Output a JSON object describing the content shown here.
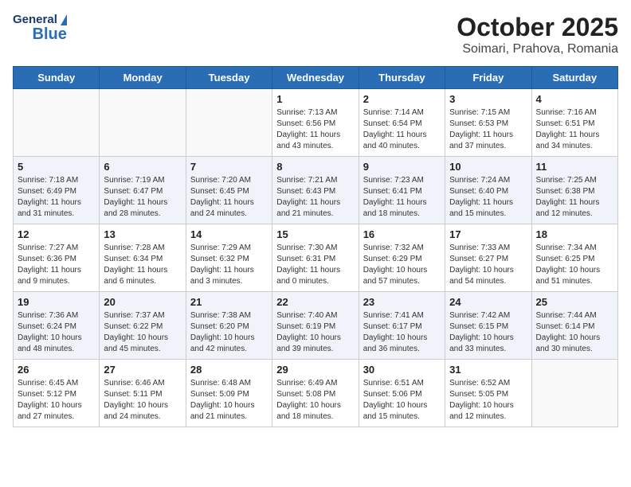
{
  "header": {
    "logo_general": "General",
    "logo_blue": "Blue",
    "title": "October 2025",
    "subtitle": "Soimari, Prahova, Romania"
  },
  "weekdays": [
    "Sunday",
    "Monday",
    "Tuesday",
    "Wednesday",
    "Thursday",
    "Friday",
    "Saturday"
  ],
  "weeks": [
    [
      {
        "day": "",
        "content": ""
      },
      {
        "day": "",
        "content": ""
      },
      {
        "day": "",
        "content": ""
      },
      {
        "day": "1",
        "content": "Sunrise: 7:13 AM\nSunset: 6:56 PM\nDaylight: 11 hours and 43 minutes."
      },
      {
        "day": "2",
        "content": "Sunrise: 7:14 AM\nSunset: 6:54 PM\nDaylight: 11 hours and 40 minutes."
      },
      {
        "day": "3",
        "content": "Sunrise: 7:15 AM\nSunset: 6:53 PM\nDaylight: 11 hours and 37 minutes."
      },
      {
        "day": "4",
        "content": "Sunrise: 7:16 AM\nSunset: 6:51 PM\nDaylight: 11 hours and 34 minutes."
      }
    ],
    [
      {
        "day": "5",
        "content": "Sunrise: 7:18 AM\nSunset: 6:49 PM\nDaylight: 11 hours and 31 minutes."
      },
      {
        "day": "6",
        "content": "Sunrise: 7:19 AM\nSunset: 6:47 PM\nDaylight: 11 hours and 28 minutes."
      },
      {
        "day": "7",
        "content": "Sunrise: 7:20 AM\nSunset: 6:45 PM\nDaylight: 11 hours and 24 minutes."
      },
      {
        "day": "8",
        "content": "Sunrise: 7:21 AM\nSunset: 6:43 PM\nDaylight: 11 hours and 21 minutes."
      },
      {
        "day": "9",
        "content": "Sunrise: 7:23 AM\nSunset: 6:41 PM\nDaylight: 11 hours and 18 minutes."
      },
      {
        "day": "10",
        "content": "Sunrise: 7:24 AM\nSunset: 6:40 PM\nDaylight: 11 hours and 15 minutes."
      },
      {
        "day": "11",
        "content": "Sunrise: 7:25 AM\nSunset: 6:38 PM\nDaylight: 11 hours and 12 minutes."
      }
    ],
    [
      {
        "day": "12",
        "content": "Sunrise: 7:27 AM\nSunset: 6:36 PM\nDaylight: 11 hours and 9 minutes."
      },
      {
        "day": "13",
        "content": "Sunrise: 7:28 AM\nSunset: 6:34 PM\nDaylight: 11 hours and 6 minutes."
      },
      {
        "day": "14",
        "content": "Sunrise: 7:29 AM\nSunset: 6:32 PM\nDaylight: 11 hours and 3 minutes."
      },
      {
        "day": "15",
        "content": "Sunrise: 7:30 AM\nSunset: 6:31 PM\nDaylight: 11 hours and 0 minutes."
      },
      {
        "day": "16",
        "content": "Sunrise: 7:32 AM\nSunset: 6:29 PM\nDaylight: 10 hours and 57 minutes."
      },
      {
        "day": "17",
        "content": "Sunrise: 7:33 AM\nSunset: 6:27 PM\nDaylight: 10 hours and 54 minutes."
      },
      {
        "day": "18",
        "content": "Sunrise: 7:34 AM\nSunset: 6:25 PM\nDaylight: 10 hours and 51 minutes."
      }
    ],
    [
      {
        "day": "19",
        "content": "Sunrise: 7:36 AM\nSunset: 6:24 PM\nDaylight: 10 hours and 48 minutes."
      },
      {
        "day": "20",
        "content": "Sunrise: 7:37 AM\nSunset: 6:22 PM\nDaylight: 10 hours and 45 minutes."
      },
      {
        "day": "21",
        "content": "Sunrise: 7:38 AM\nSunset: 6:20 PM\nDaylight: 10 hours and 42 minutes."
      },
      {
        "day": "22",
        "content": "Sunrise: 7:40 AM\nSunset: 6:19 PM\nDaylight: 10 hours and 39 minutes."
      },
      {
        "day": "23",
        "content": "Sunrise: 7:41 AM\nSunset: 6:17 PM\nDaylight: 10 hours and 36 minutes."
      },
      {
        "day": "24",
        "content": "Sunrise: 7:42 AM\nSunset: 6:15 PM\nDaylight: 10 hours and 33 minutes."
      },
      {
        "day": "25",
        "content": "Sunrise: 7:44 AM\nSunset: 6:14 PM\nDaylight: 10 hours and 30 minutes."
      }
    ],
    [
      {
        "day": "26",
        "content": "Sunrise: 6:45 AM\nSunset: 5:12 PM\nDaylight: 10 hours and 27 minutes."
      },
      {
        "day": "27",
        "content": "Sunrise: 6:46 AM\nSunset: 5:11 PM\nDaylight: 10 hours and 24 minutes."
      },
      {
        "day": "28",
        "content": "Sunrise: 6:48 AM\nSunset: 5:09 PM\nDaylight: 10 hours and 21 minutes."
      },
      {
        "day": "29",
        "content": "Sunrise: 6:49 AM\nSunset: 5:08 PM\nDaylight: 10 hours and 18 minutes."
      },
      {
        "day": "30",
        "content": "Sunrise: 6:51 AM\nSunset: 5:06 PM\nDaylight: 10 hours and 15 minutes."
      },
      {
        "day": "31",
        "content": "Sunrise: 6:52 AM\nSunset: 5:05 PM\nDaylight: 10 hours and 12 minutes."
      },
      {
        "day": "",
        "content": ""
      }
    ]
  ]
}
